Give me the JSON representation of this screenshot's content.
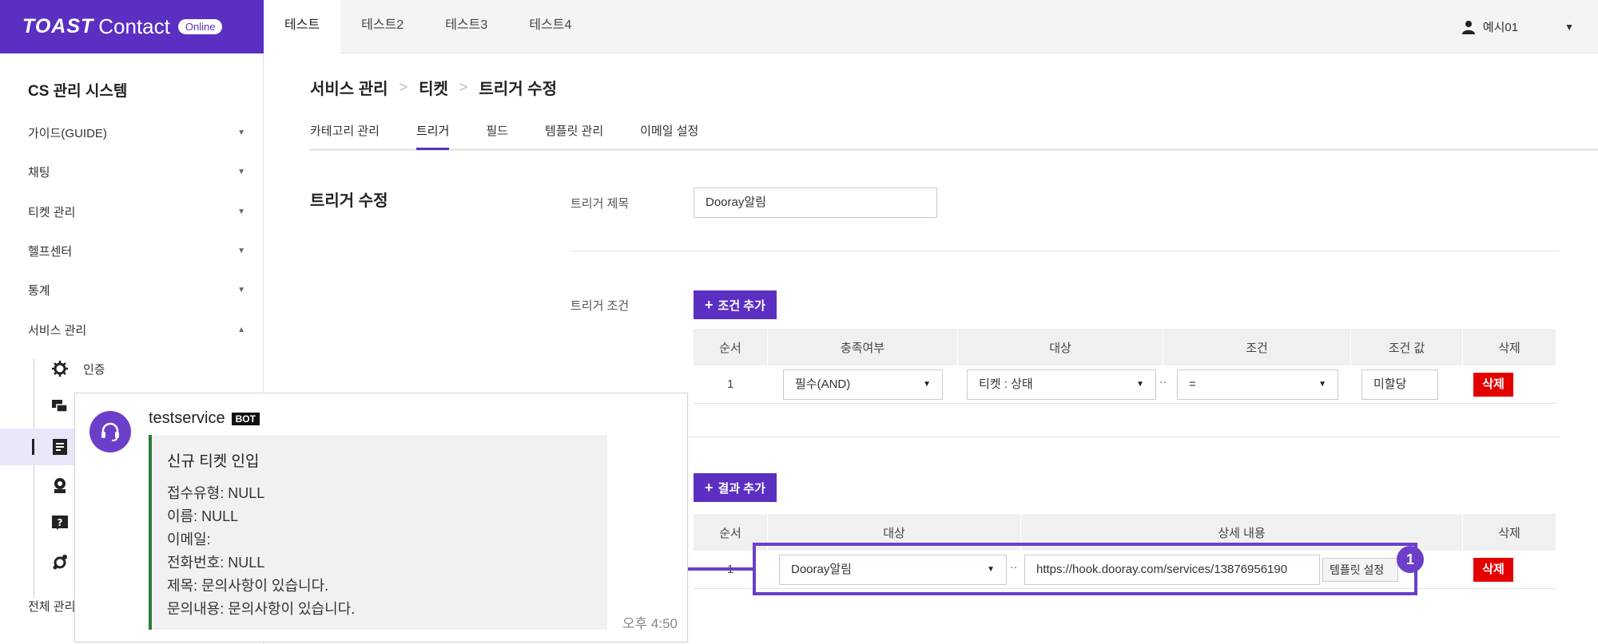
{
  "topbar": {
    "brand_main": "TOAST",
    "brand_sub": "Contact",
    "brand_badge": "Online",
    "tabs": [
      "테스트",
      "테스트2",
      "테스트3",
      "테스트4"
    ],
    "user_name": "예시01"
  },
  "sidebar": {
    "title": "CS 관리 시스템",
    "items": [
      {
        "label": "가이드(GUIDE)"
      },
      {
        "label": "채팅"
      },
      {
        "label": "티켓 관리"
      },
      {
        "label": "헬프센터"
      },
      {
        "label": "통계"
      },
      {
        "label": "서비스 관리"
      }
    ],
    "sub_items": [
      {
        "label": "인증"
      }
    ],
    "footer_item": "전체 관리"
  },
  "main": {
    "breadcrumb": [
      "서비스 관리",
      "티켓",
      "트리거 수정"
    ],
    "subtabs": [
      "카테고리 관리",
      "트리거",
      "필드",
      "템플릿 관리",
      "이메일 설정"
    ],
    "section_title": "트리거 수정",
    "trigger_title_label": "트리거 제목",
    "trigger_title_value": "Dooray알림",
    "trigger_condition_label": "트리거 조건",
    "add_condition_label": "조건 추가",
    "condition_table": {
      "headers": [
        "순서",
        "충족여부",
        "대상",
        "조건",
        "조건 값",
        "삭제"
      ],
      "rows": [
        {
          "order": "1",
          "fulfill": "필수(AND)",
          "target": "티켓 : 상태",
          "condition": "=",
          "value": "미할당",
          "delete": "삭제"
        }
      ]
    },
    "add_result_label": "결과 추가",
    "result_table": {
      "headers": [
        "순서",
        "대상",
        "상세 내용",
        "삭제"
      ],
      "rows": [
        {
          "order": "1",
          "target": "Dooray알림",
          "detail": "https://hook.dooray.com/services/13876956190",
          "template_btn": "템플릿 설정",
          "delete": "삭제"
        }
      ]
    },
    "callout_number": "1"
  },
  "chat": {
    "sender": "testservice",
    "bot_tag": "BOT",
    "header": "신규 티켓 인입",
    "lines": [
      "접수유형: NULL",
      "이름: NULL",
      "이메일:",
      "전화번호: NULL",
      "제목: 문의사항이 있습니다.",
      "문의내용: 문의사항이 있습니다."
    ],
    "time": "오후 4:50"
  },
  "colors": {
    "brand": "#5a2fc2",
    "delete": "#e50000",
    "highlight": "#6b3fc9",
    "chat_border": "#2c7a3a"
  }
}
